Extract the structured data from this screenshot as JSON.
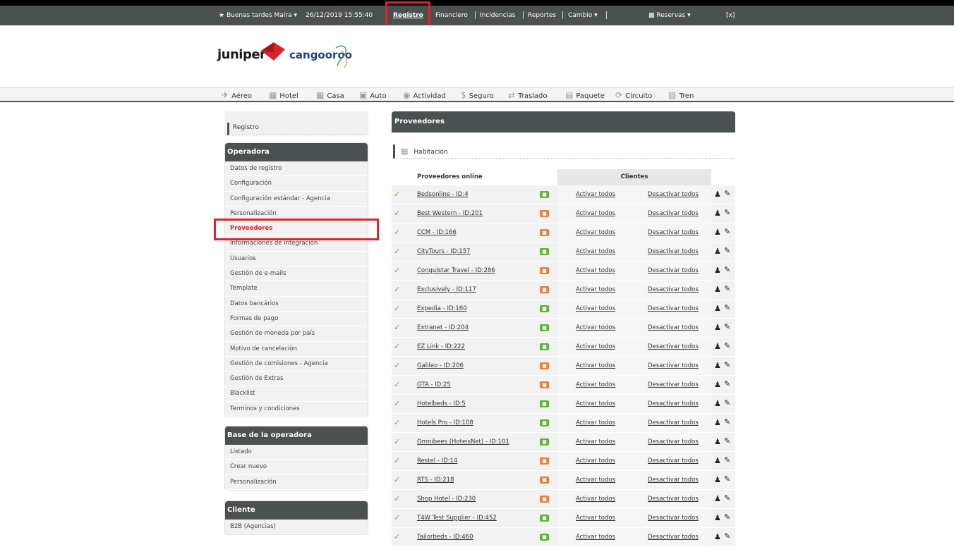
{
  "topbar": {
    "greeting": "Buenas tardes Maíra",
    "datetime": "26/12/2019 15:55:40",
    "nav": [
      "Registro",
      "Financiero",
      "Incidencias",
      "Reportes",
      "Cambio"
    ],
    "reservas": "Reservas",
    "close": "[x]"
  },
  "logo": {
    "juniper": "juniper",
    "cangooroo": "cangooroo"
  },
  "services": [
    {
      "label": "Aéreo",
      "icon": "plane-icon"
    },
    {
      "label": "Hotel",
      "icon": "hotel-icon"
    },
    {
      "label": "Casa",
      "icon": "house-icon"
    },
    {
      "label": "Auto",
      "icon": "car-icon"
    },
    {
      "label": "Actividad",
      "icon": "activity-icon"
    },
    {
      "label": "Seguro",
      "icon": "dollar-icon"
    },
    {
      "label": "Traslado",
      "icon": "transfer-icon"
    },
    {
      "label": "Paquete",
      "icon": "package-icon"
    },
    {
      "label": "Circuito",
      "icon": "circuit-icon"
    },
    {
      "label": "Tren",
      "icon": "train-icon"
    }
  ],
  "sidebar": {
    "top_label": "Registro",
    "operadora": {
      "title": "Operadora",
      "items": [
        "Datos de registro",
        "Configuración",
        "Configuración estándar - Agencia",
        "Personalización",
        "Proveedores",
        "Informaciones de integración",
        "Usuarios",
        "Gestión de e-mails",
        "Template",
        "Datos bancários",
        "Formas de pago",
        "Gestión de moneda por país",
        "Motivo de cancelación",
        "Gestión de comisiones - Agencia",
        "Gestión de Extras",
        "Blacklist",
        "Terminos y condiciones"
      ],
      "active": "Proveedores"
    },
    "base": {
      "title": "Base de la operadora",
      "items": [
        "Listado",
        "Crear nuevo",
        "Personalización"
      ]
    },
    "cliente": {
      "title": "Cliente",
      "items": [
        "B2B (Agencias)"
      ]
    }
  },
  "main": {
    "title": "Proveedores",
    "subtitle": "Habitación",
    "col_providers": "Proveedores online",
    "col_clients": "Clientes",
    "activate_label": "Activar todos",
    "deactivate_label": "Desactivar todos",
    "rows": [
      {
        "name": "Bedsonline - ID:4",
        "status": "green"
      },
      {
        "name": "Best Western - ID:201",
        "status": "orange"
      },
      {
        "name": "CCM - ID:166",
        "status": "orange"
      },
      {
        "name": "CityTours - ID:157",
        "status": "green"
      },
      {
        "name": "Conquistar Travel - ID:286",
        "status": "orange"
      },
      {
        "name": "Exclusively - ID:117",
        "status": "orange"
      },
      {
        "name": "Expedia - ID:160",
        "status": "green"
      },
      {
        "name": "Extranet - ID:204",
        "status": "green"
      },
      {
        "name": "EZ Link - ID:222",
        "status": "green"
      },
      {
        "name": "Galileo - ID:206",
        "status": "orange"
      },
      {
        "name": "GTA - ID:25",
        "status": "orange"
      },
      {
        "name": "Hotelbeds - ID:5",
        "status": "green"
      },
      {
        "name": "Hotels Pro - ID:108",
        "status": "green"
      },
      {
        "name": "Omnibees (HoteisNet) - ID:101",
        "status": "green"
      },
      {
        "name": "Restel - ID:14",
        "status": "orange"
      },
      {
        "name": "RTS - ID:218",
        "status": "orange"
      },
      {
        "name": "Shop Hotel - ID:230",
        "status": "orange"
      },
      {
        "name": "T4W Test Supplier - ID:452",
        "status": "green"
      },
      {
        "name": "Tailorbeds - ID:460",
        "status": "green"
      }
    ]
  },
  "colors": {
    "dark": "#4a5150",
    "highlight": "#e5222a",
    "green": "#5cb531",
    "orange": "#f07a3c",
    "check": "#6ab63b"
  }
}
